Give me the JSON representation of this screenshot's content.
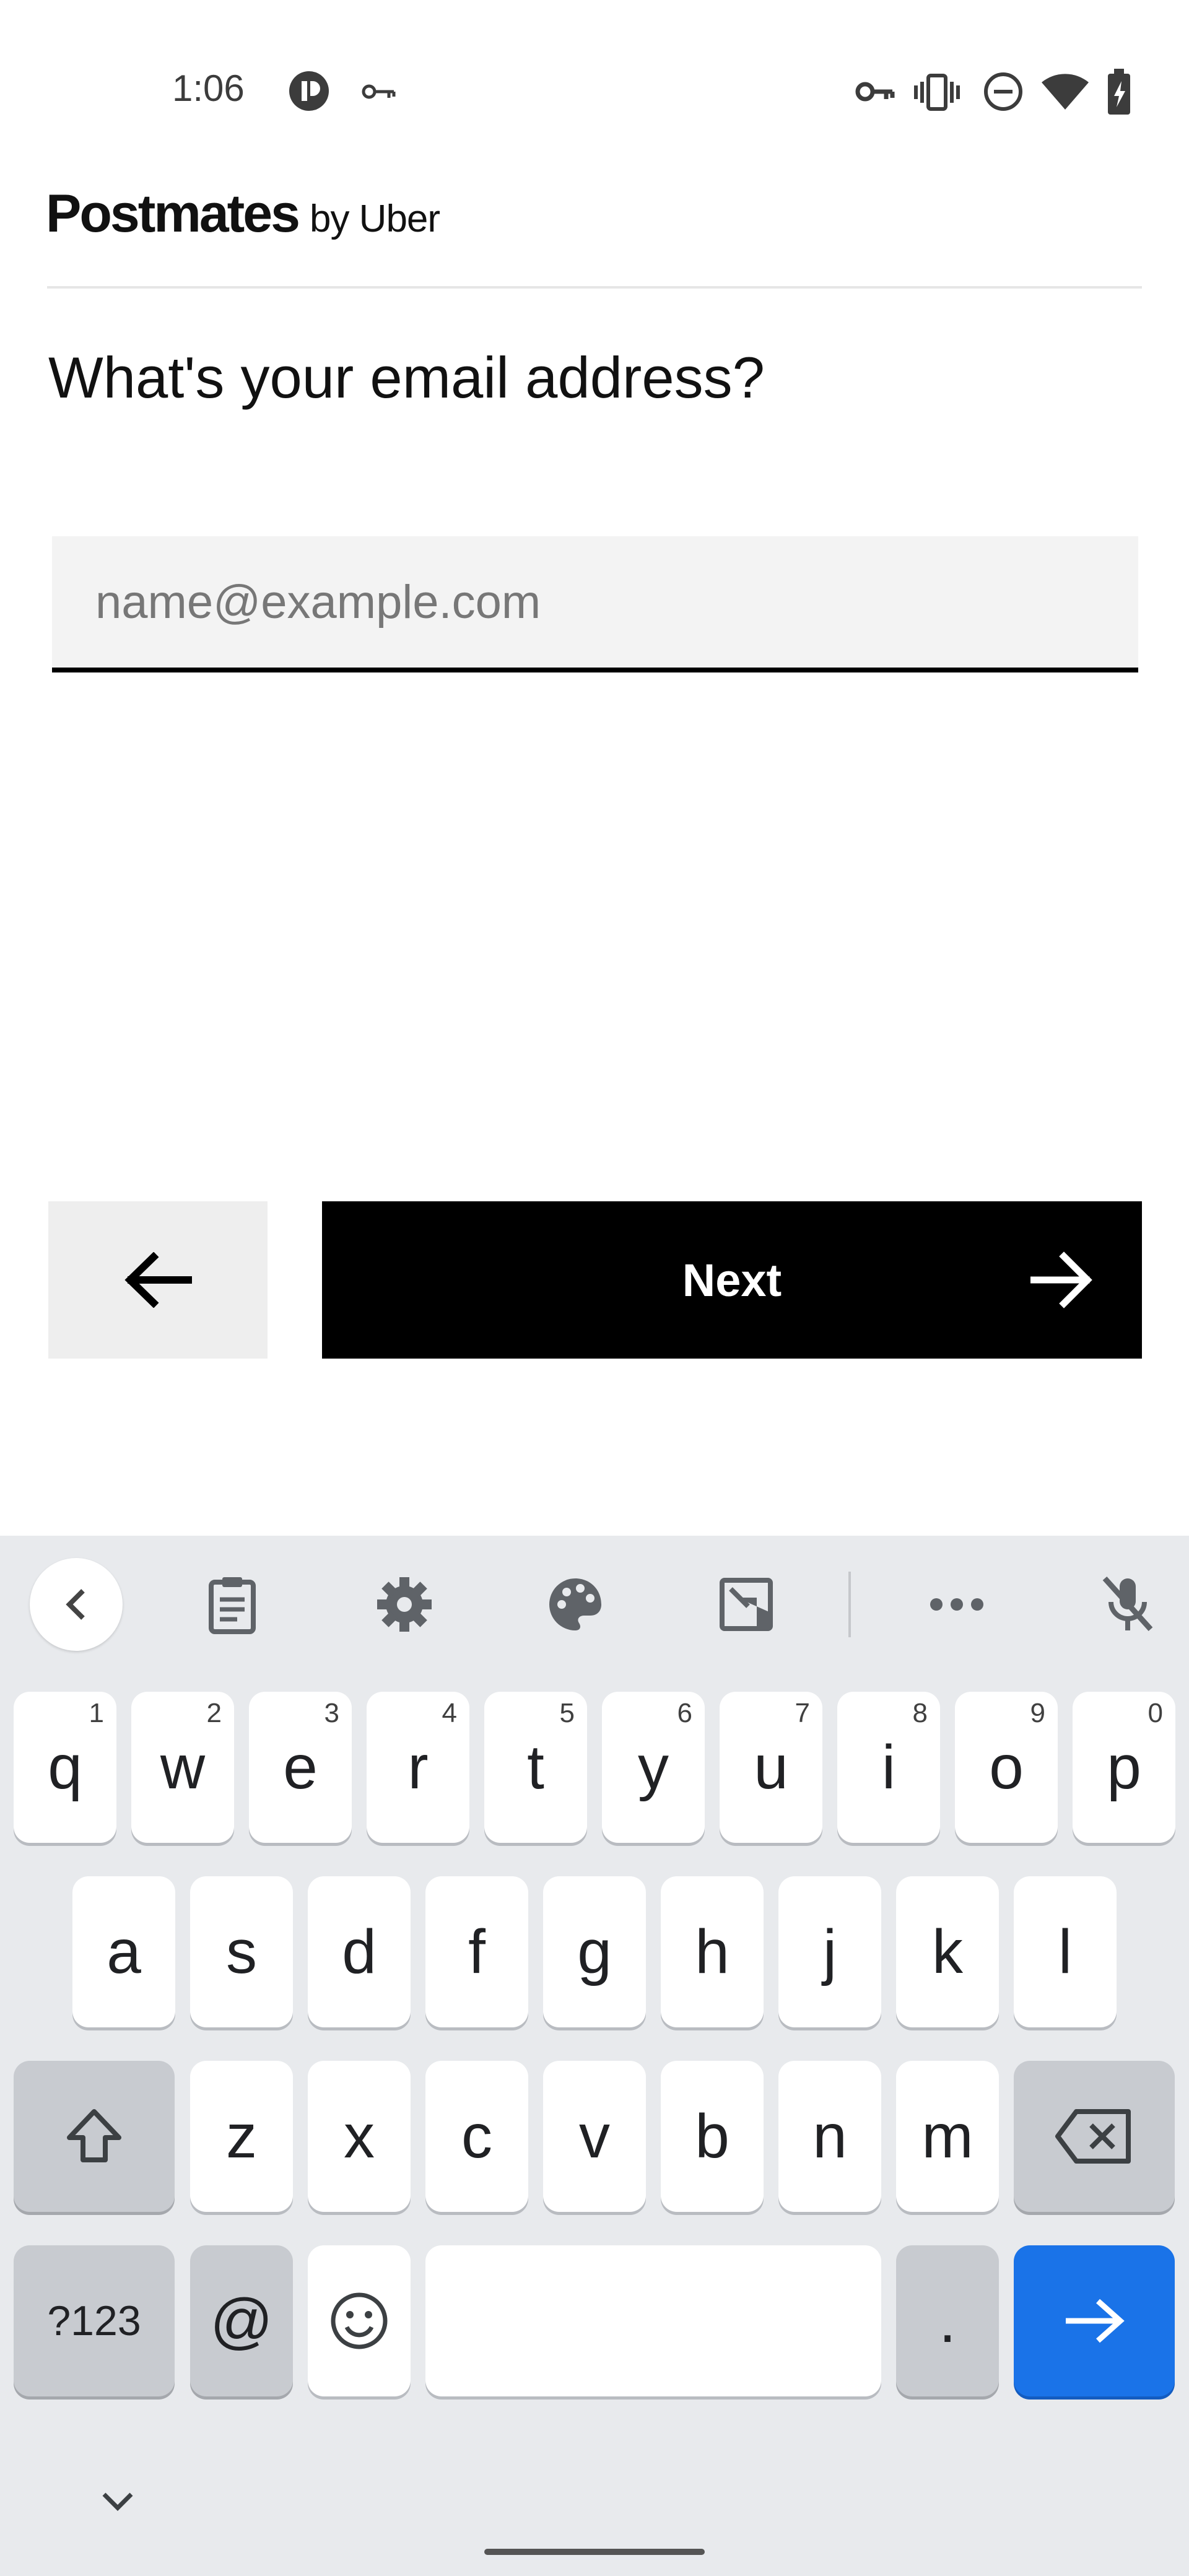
{
  "status_bar": {
    "time": "1:06",
    "left_icons": [
      "screen-record-icon",
      "vpn-key-icon"
    ],
    "right_icons": [
      "vpn-key-icon",
      "vibrate-icon",
      "do-not-disturb-icon",
      "wifi-icon",
      "battery-icon"
    ]
  },
  "header": {
    "brand": "Postmates",
    "brand_suffix": "by Uber"
  },
  "form": {
    "question": "What's your email address?",
    "email_value": "",
    "email_placeholder": "name@example.com"
  },
  "actions": {
    "back_icon": "arrow-left-icon",
    "next_label": "Next",
    "next_icon": "arrow-right-icon"
  },
  "keyboard": {
    "toolbar": [
      "chevron-left-icon",
      "clipboard-icon",
      "settings-icon",
      "palette-icon",
      "one-handed-icon",
      "more-icon",
      "mic-off-icon"
    ],
    "row1": [
      {
        "k": "q",
        "h": "1"
      },
      {
        "k": "w",
        "h": "2"
      },
      {
        "k": "e",
        "h": "3"
      },
      {
        "k": "r",
        "h": "4"
      },
      {
        "k": "t",
        "h": "5"
      },
      {
        "k": "y",
        "h": "6"
      },
      {
        "k": "u",
        "h": "7"
      },
      {
        "k": "i",
        "h": "8"
      },
      {
        "k": "o",
        "h": "9"
      },
      {
        "k": "p",
        "h": "0"
      }
    ],
    "row2": [
      "a",
      "s",
      "d",
      "f",
      "g",
      "h",
      "j",
      "k",
      "l"
    ],
    "row3": [
      "z",
      "x",
      "c",
      "v",
      "b",
      "n",
      "m"
    ],
    "symbols_label": "?123",
    "at_label": "@",
    "period_label": ".",
    "hide_icon": "chevron-down-icon"
  }
}
